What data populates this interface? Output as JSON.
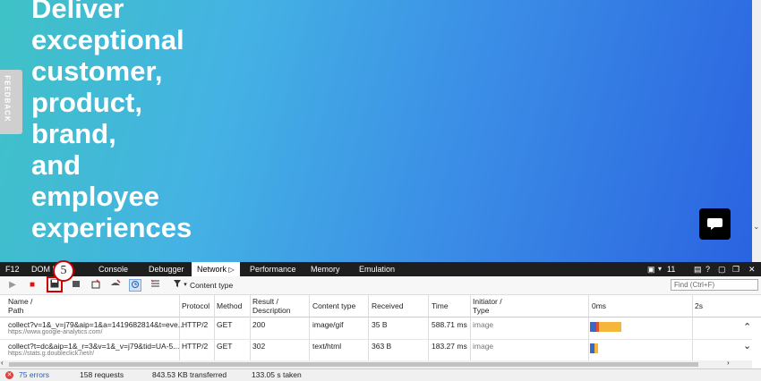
{
  "hero": {
    "title_lines": [
      "Deliver",
      "exceptional",
      "customer,",
      "product,",
      "brand,",
      "and",
      "employee",
      "experiences"
    ],
    "feedback_label": "FEEDBACK"
  },
  "devtools": {
    "f12_label": "F12",
    "tabs": [
      "DOM E",
      "Console",
      "Debugger",
      "Network",
      "Performance",
      "Memory",
      "Emulation"
    ],
    "active_tab": "Network",
    "monitor_count": "11",
    "help_label": "?",
    "step_number": "5",
    "content_type_filter": "Content type",
    "find_placeholder": "Find (Ctrl+F)",
    "columns": {
      "name": "Name /",
      "path": "Path",
      "protocol": "Protocol",
      "method": "Method",
      "result": "Result /",
      "description": "Description",
      "content_type": "Content type",
      "received": "Received",
      "time": "Time",
      "initiator": "Initiator /",
      "type": "Type",
      "timeline_start": "0ms",
      "timeline_mark": "2s"
    },
    "rows": [
      {
        "name": "collect?v=1&_v=j79&aip=1&a=1419682814&t=eve...",
        "path": "https://www.google-analytics.com/",
        "protocol": "HTTP/2",
        "method": "GET",
        "result": "200",
        "content_type": "image/gif",
        "received": "35 B",
        "time": "588.71 ms",
        "initiator": "image"
      },
      {
        "name": "collect?t=dc&aip=1&_r=3&v=1&_v=j79&tid=UA-5...",
        "path": "https://stats.g.doubleclick.net/r/",
        "protocol": "HTTP/2",
        "method": "GET",
        "result": "302",
        "content_type": "text/html",
        "received": "363 B",
        "time": "183.27 ms",
        "initiator": "image"
      }
    ],
    "status": {
      "errors": "75 errors",
      "requests": "158 requests",
      "transferred": "843.53 KB transferred",
      "taken": "133.05 s taken"
    }
  },
  "colors": {
    "hero_start": "#3fc2c6",
    "hero_end": "#2a62e0",
    "highlight": "#cc0000",
    "timing_blue": "#3c66c4",
    "timing_orange": "#f5b63c"
  }
}
